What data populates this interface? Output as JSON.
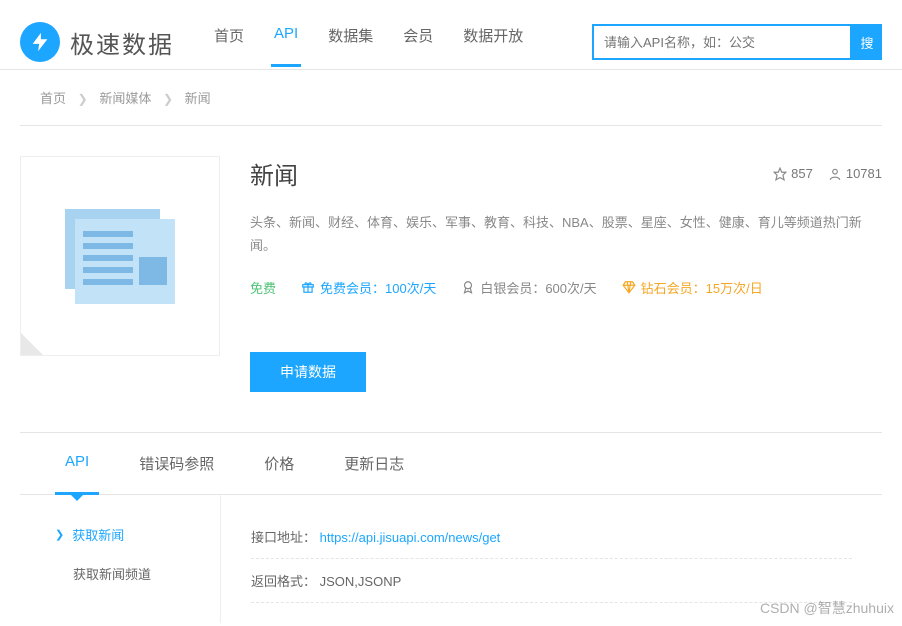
{
  "header": {
    "logo_text": "极速数据",
    "nav": [
      "首页",
      "API",
      "数据集",
      "会员",
      "数据开放"
    ],
    "active_nav_index": 1,
    "search_placeholder": "请输入API名称，如：公交",
    "search_btn": "搜"
  },
  "breadcrumb": [
    "首页",
    "新闻媒体",
    "新闻"
  ],
  "detail": {
    "title": "新闻",
    "stars": "857",
    "users": "10781",
    "description": "头条、新闻、财经、体育、娱乐、军事、教育、科技、NBA、股票、星座、女性、健康、育儿等频道热门新闻。",
    "free_label": "免费",
    "tiers": {
      "bronze": "免费会员：100次/天",
      "silver": "白银会员：600次/天",
      "gold": "钻石会员：15万次/日"
    },
    "apply_btn": "申请数据"
  },
  "tabs": [
    "API",
    "错误码参照",
    "价格",
    "更新日志"
  ],
  "active_tab_index": 0,
  "sidebar": {
    "items": [
      "获取新闻",
      "获取新闻频道"
    ],
    "active_index": 0
  },
  "api": {
    "endpoint_label": "接口地址：",
    "endpoint_url": "https://api.jisuapi.com/news/get",
    "format_label": "返回格式：",
    "format_value": "JSON,JSONP"
  },
  "watermark": "CSDN @智慧zhuhuix"
}
